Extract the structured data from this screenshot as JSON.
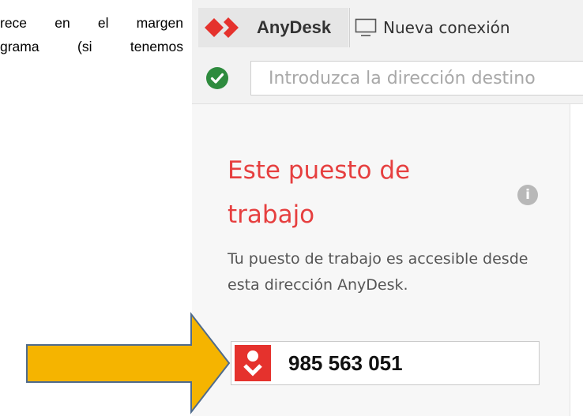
{
  "document": {
    "lines": [
      "rece en el margen",
      "grama (si tenemos"
    ]
  },
  "app": {
    "name": "AnyDesk",
    "brand_color": "#e5322d"
  },
  "tabs": {
    "new_connection_label": "Nueva conexión"
  },
  "addressbar": {
    "status_icon": "check-circle-icon",
    "placeholder": "Introduzca la dirección destino"
  },
  "this_desk": {
    "title": "Este puesto de trabajo",
    "description": "Tu puesto de trabajo es accesible desde esta dirección AnyDesk.",
    "id_icon": "anydesk-id-icon",
    "address": "985 563 051",
    "info_icon": "info-icon",
    "info_glyph": "i"
  },
  "annotation": {
    "arrow_color": "#f5b400"
  }
}
